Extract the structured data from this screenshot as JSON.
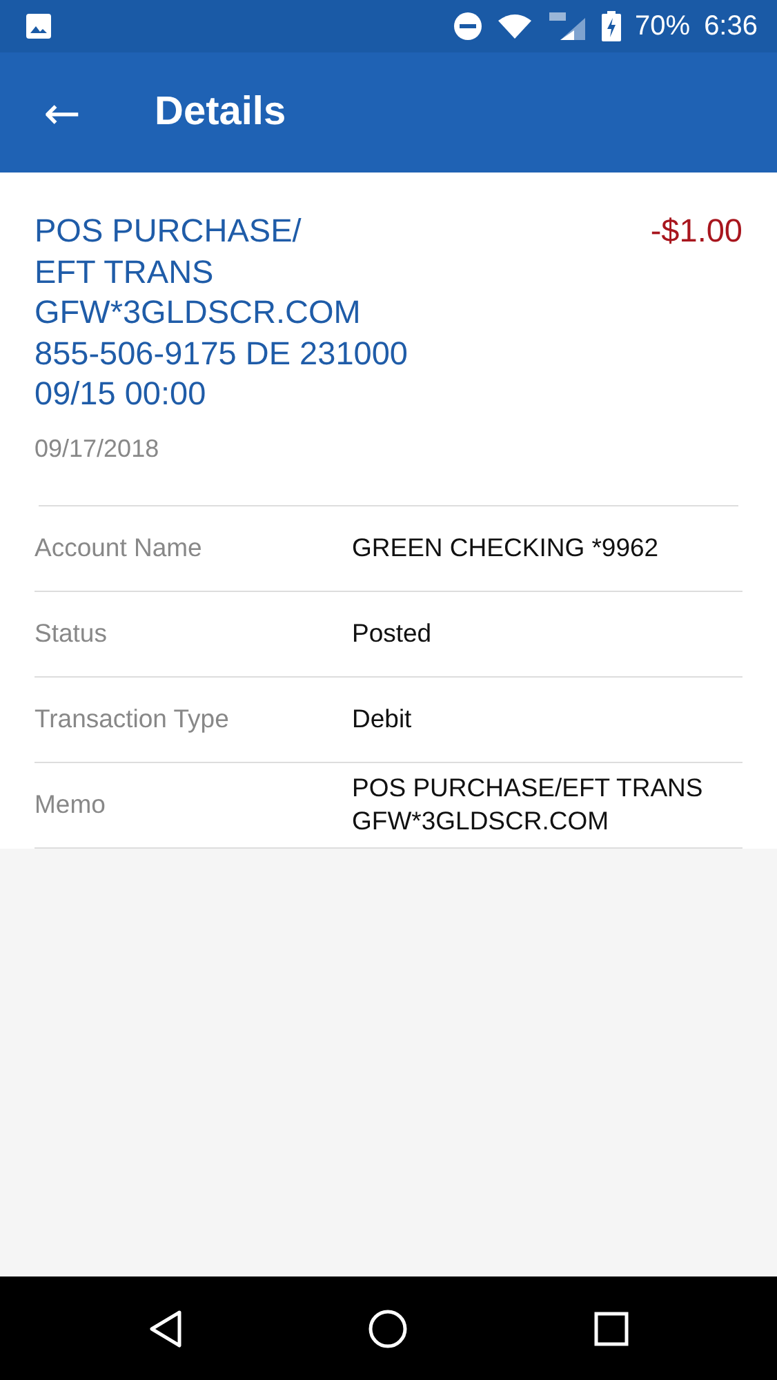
{
  "status_bar": {
    "battery": "70%",
    "time": "6:36"
  },
  "app_bar": {
    "back": "←",
    "title": "Details"
  },
  "transaction": {
    "description": [
      "POS PURCHASE/",
      "EFT TRANS",
      "GFW*3GLDSCR.COM",
      "855-506-9175 DE 231000",
      "09/15 00:00"
    ],
    "amount": "-$1.00",
    "date": "09/17/2018"
  },
  "fields": [
    {
      "label": "Account Name",
      "value": "GREEN CHECKING *9962"
    },
    {
      "label": "Status",
      "value": "Posted"
    },
    {
      "label": "Transaction Type",
      "value": "Debit"
    },
    {
      "label": "Memo",
      "value": "POS PURCHASE/EFT TRANS GFW*3GLDSCR.COM"
    }
  ]
}
